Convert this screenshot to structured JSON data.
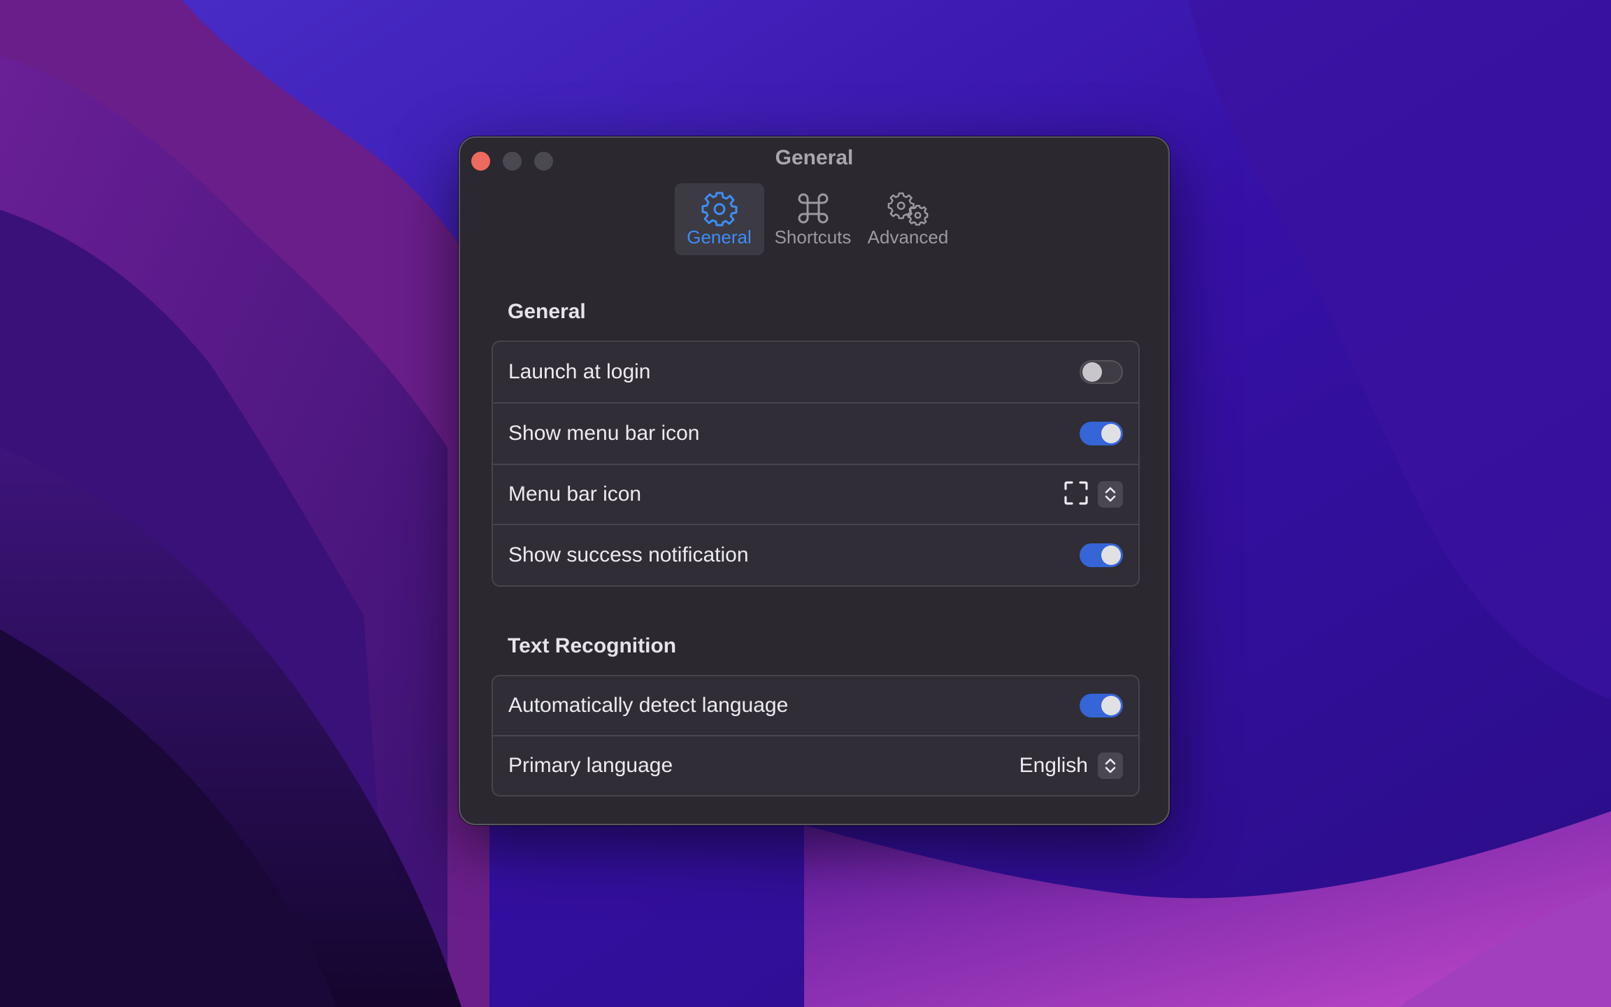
{
  "window": {
    "title": "General"
  },
  "tabs": [
    {
      "label": "General",
      "icon": "gear-icon",
      "selected": true
    },
    {
      "label": "Shortcuts",
      "icon": "command-icon",
      "selected": false
    },
    {
      "label": "Advanced",
      "icon": "gears-icon",
      "selected": false
    }
  ],
  "general": {
    "title": "General",
    "rows": [
      {
        "label": "Launch at login",
        "control": "toggle",
        "on": false
      },
      {
        "label": "Show menu bar icon",
        "control": "toggle",
        "on": true
      },
      {
        "label": "Menu bar icon",
        "control": "picker",
        "value_icon": "viewfinder-icon"
      },
      {
        "label": "Show success notification",
        "control": "toggle",
        "on": true
      }
    ]
  },
  "text_recognition": {
    "title": "Text Recognition",
    "rows": [
      {
        "label": "Automatically detect language",
        "control": "toggle",
        "on": true
      },
      {
        "label": "Primary language",
        "control": "picker",
        "value": "English"
      }
    ]
  },
  "colors": {
    "accent": "#3f8df5",
    "toggle_on": "#3565d6",
    "close_button": "#ec6a5e",
    "window_bg": "#2b2830"
  }
}
